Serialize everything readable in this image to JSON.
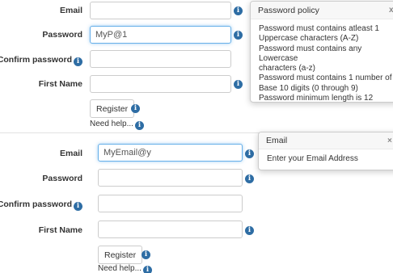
{
  "form1": {
    "email_label": "Email",
    "email_value": "",
    "password_label": "Password",
    "password_value": "MyP@1",
    "confirm_label": "Confirm password",
    "confirm_value": "",
    "firstname_label": "First Name",
    "firstname_value": "",
    "register_label": "Register",
    "help_label": "Need help..."
  },
  "policy_popover": {
    "title": "Password policy",
    "close_glyph": "x",
    "lines": [
      "Password must contains atleast 1",
      "Uppercase characters (A-Z)",
      "Password must contains any Lowercase",
      "characters (a-z)",
      "Password must contains 1 number of",
      "Base 10 digits (0 through 9)",
      "Password minimum length is 12"
    ]
  },
  "form2": {
    "email_label": "Email",
    "email_value": "MyEmail@y",
    "password_label": "Password",
    "password_value": "",
    "confirm_label": "Confirm password",
    "confirm_value": "",
    "firstname_label": "First Name",
    "firstname_value": "",
    "register_label": "Register",
    "help_label": "Need help..."
  },
  "email_popover": {
    "title": "Email",
    "close_glyph": "×",
    "body": "Enter your Email Address"
  },
  "icons": {
    "info_glyph": "i"
  },
  "colors": {
    "info_icon": "#2e6da4",
    "focus_border": "#66afe9",
    "input_border": "#cccccc"
  }
}
